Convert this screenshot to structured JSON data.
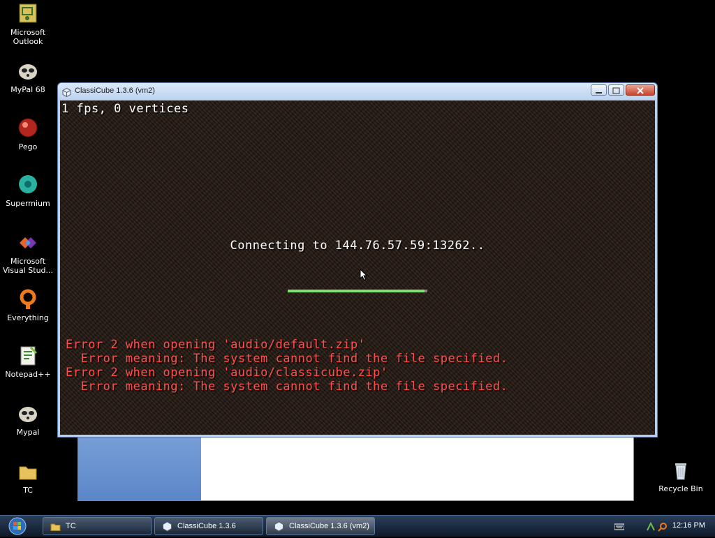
{
  "desktop": {
    "icons": [
      {
        "label": "Microsoft Outlook",
        "icon": "outlook-icon"
      },
      {
        "label": "MyPal 68",
        "icon": "mypal-icon"
      },
      {
        "label": "Pego",
        "icon": "pego-icon"
      },
      {
        "label": "Supermium",
        "icon": "supermium-icon"
      },
      {
        "label": "Microsoft Visual Stud...",
        "icon": "visual-studio-icon"
      },
      {
        "label": "Everything",
        "icon": "everything-icon"
      },
      {
        "label": "Notepad++",
        "icon": "notepadpp-icon"
      },
      {
        "label": "Mypal",
        "icon": "mypal-icon"
      },
      {
        "label": "TC",
        "icon": "folder-icon"
      },
      {
        "label": "Recycle Bin",
        "icon": "recycle-bin-icon"
      }
    ]
  },
  "game_window": {
    "title": "ClassiCube 1.3.6 (vm2)",
    "fps_text": "1 fps, 0 vertices",
    "status_text": "Connecting to 144.76.57.59:13262..",
    "progress": 0.98,
    "errors": [
      "Error 2 when opening 'audio/default.zip'",
      "  Error meaning: The system cannot find the file specified.",
      "Error 2 when opening 'audio/classicube.zip'",
      "  Error meaning: The system cannot find the file specified."
    ]
  },
  "taskbar": {
    "tasks": [
      {
        "label": "TC",
        "icon": "folder-icon"
      },
      {
        "label": "ClassiCube 1.3.6",
        "icon": "classicube-icon"
      },
      {
        "label": "ClassiCube 1.3.6 (vm2)",
        "icon": "classicube-icon"
      }
    ],
    "clock": "12:16 PM"
  },
  "colors": {
    "error_text": "#ff4d4d",
    "progress_fill": "#80e070",
    "progress_track": "#808080"
  }
}
